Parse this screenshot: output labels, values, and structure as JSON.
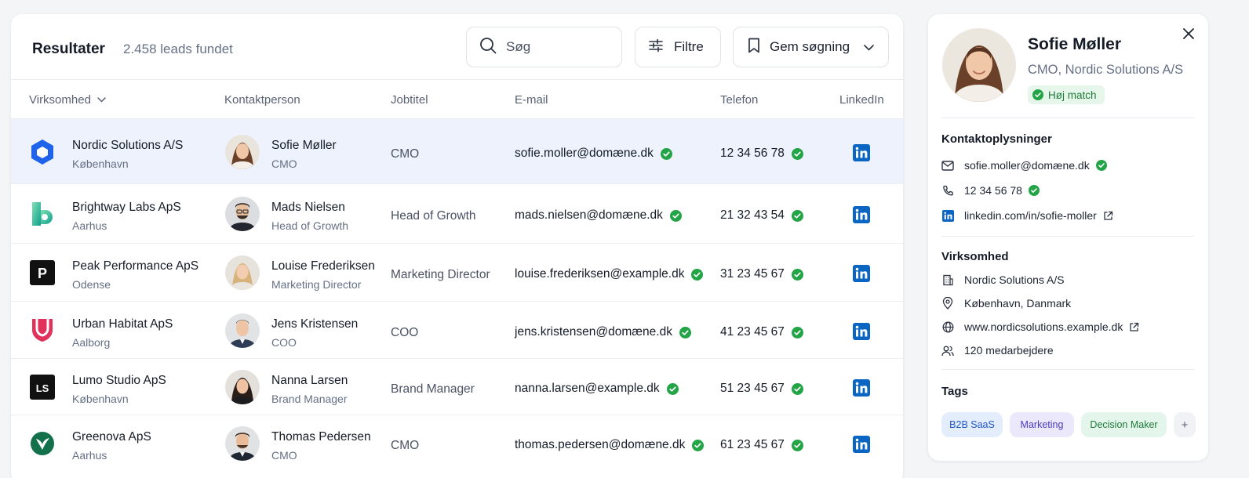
{
  "header": {
    "title": "Resultater",
    "count": "2.458 leads fundet",
    "search_placeholder": "Søg",
    "filter_label": "Filtre",
    "save_label": "Gem søgning"
  },
  "columns": {
    "company": "Virksomhed",
    "contact": "Kontaktperson",
    "job": "Jobtitel",
    "email": "E-mail",
    "phone": "Telefon",
    "linkedin": "LinkedIn"
  },
  "rows": [
    {
      "company": "Nordic Solutions A/S",
      "city": "København",
      "name": "Sofie Møller",
      "title": "CMO",
      "job": "CMO",
      "email": "sofie.moller@domæne.dk",
      "phone": "12 34 56 78",
      "selected": true
    },
    {
      "company": "Brightway Labs ApS",
      "city": "Aarhus",
      "name": "Mads Nielsen",
      "title": "Head of Growth",
      "job": "Head of Growth",
      "email": "mads.nielsen@domæne.dk",
      "phone": "21 32 43 54",
      "selected": false
    },
    {
      "company": "Peak Performance ApS",
      "city": "Odense",
      "name": "Louise Frederiksen",
      "title": "Marketing Director",
      "job": "Marketing Director",
      "email": "louise.frederiksen@example.dk",
      "phone": "31 23 45 67",
      "selected": false
    },
    {
      "company": "Urban Habitat ApS",
      "city": "Aalborg",
      "name": "Jens Kristensen",
      "title": "COO",
      "job": "COO",
      "email": "jens.kristensen@domæne.dk",
      "phone": "41 23 45 67",
      "selected": false
    },
    {
      "company": "Lumo Studio ApS",
      "city": "København",
      "name": "Nanna Larsen",
      "title": "Brand Manager",
      "job": "Brand Manager",
      "email": "nanna.larsen@example.dk",
      "phone": "51 23 45 67",
      "selected": false
    },
    {
      "company": "Greenova ApS",
      "city": "Aarhus",
      "name": "Thomas Pedersen",
      "title": "CMO",
      "job": "CMO",
      "email": "thomas.pedersen@domæne.dk",
      "phone": "61 23 45 67",
      "selected": false
    }
  ],
  "logos": [
    {
      "icon": "hexagon-logo-icon",
      "color": "#1e63e9"
    },
    {
      "icon": "b-logo-icon",
      "color": "#2ec4a0",
      "letter": "B"
    },
    {
      "icon": "p-logo-icon",
      "color": "#111111",
      "letter": "P"
    },
    {
      "icon": "shield-logo-icon",
      "color": "#e0325a"
    },
    {
      "icon": "ls-logo-icon",
      "color": "#111111",
      "letter": "LS"
    },
    {
      "icon": "leaf-logo-icon",
      "color": "#12704a"
    }
  ],
  "panel": {
    "name": "Sofie Møller",
    "role": "CMO, Nordic Solutions A/S",
    "match": "Høj match",
    "contact_heading": "Kontaktoplysninger",
    "email": "sofie.moller@domæne.dk",
    "phone": "12 34 56 78",
    "linkedin": "linkedin.com/in/sofie-moller",
    "company_heading": "Virksomhed",
    "company": "Nordic Solutions A/S",
    "location": "København, Danmark",
    "website": "www.nordicsolutions.example.dk",
    "employees": "120 medarbejdere",
    "tags_heading": "Tags",
    "tags": [
      "B2B SaaS",
      "Marketing",
      "Decision Maker"
    ],
    "add_tag": "+"
  },
  "colors": {
    "accent": "#1e63e9",
    "verified": "#22a447",
    "linkedin": "#0a66c2",
    "selected_row": "#edf2fc"
  }
}
